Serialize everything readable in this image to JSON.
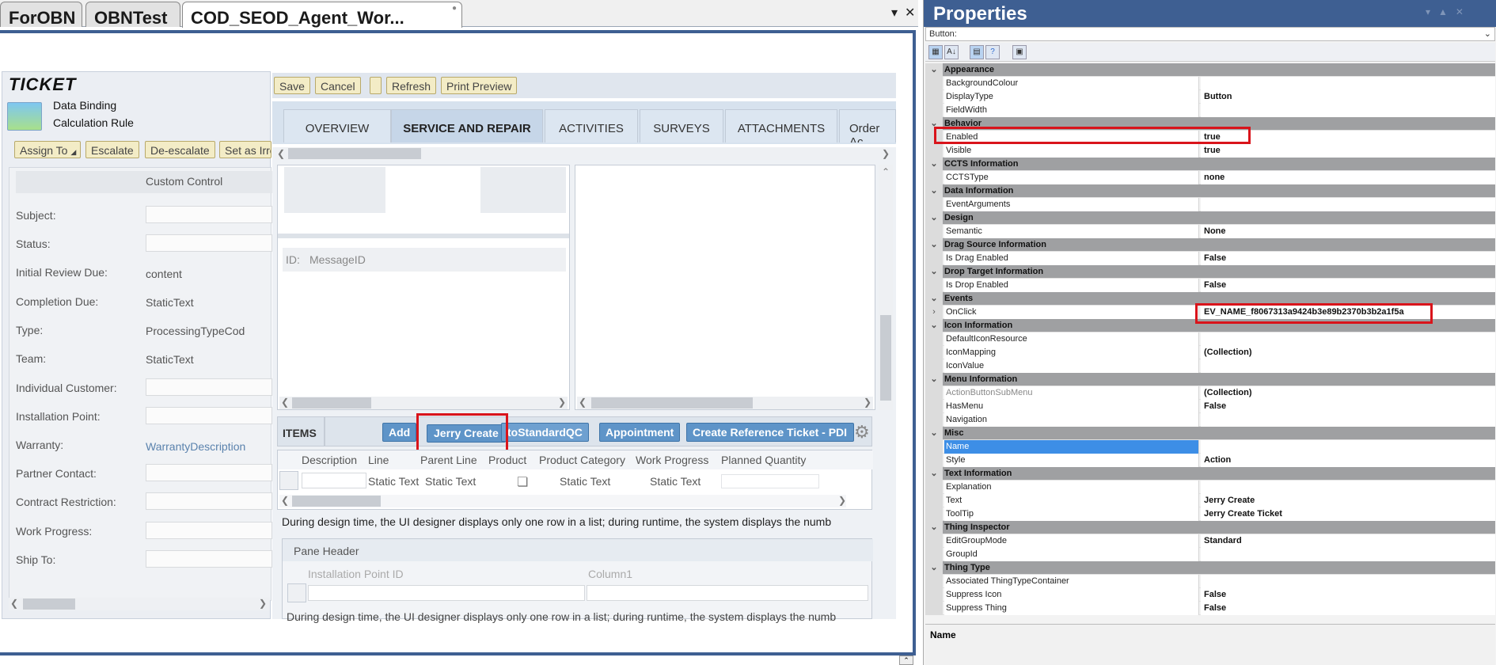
{
  "doc_tabs": [
    "ForOBN",
    "OBNTest",
    "COD_SEOD_Agent_Wor..."
  ],
  "ticket": {
    "title": "TICKET",
    "data_binding": "Data Binding",
    "calc_rule": "Calculation Rule",
    "actions": [
      "Assign To",
      "Escalate",
      "De-escalate",
      "Set as Irre"
    ],
    "custom_control": "Custom Control",
    "fields": [
      {
        "label": "Subject:",
        "value": ""
      },
      {
        "label": "Status:",
        "value": ""
      },
      {
        "label": "Initial Review Due:",
        "value": "content"
      },
      {
        "label": "Completion Due:",
        "value": "StaticText"
      },
      {
        "label": "Type:",
        "value": "ProcessingTypeCode"
      },
      {
        "label": "Team:",
        "value": "StaticText"
      },
      {
        "label": "Individual Customer:",
        "value": ""
      },
      {
        "label": "Installation Point:",
        "value": ""
      },
      {
        "label": "Warranty:",
        "value": "WarrantyDescription"
      },
      {
        "label": "Partner Contact:",
        "value": ""
      },
      {
        "label": "Contract Restriction:",
        "value": ""
      },
      {
        "label": "Work Progress:",
        "value": ""
      },
      {
        "label": "Ship To:",
        "value": ""
      }
    ]
  },
  "toolbar": {
    "save": "Save",
    "cancel": "Cancel",
    "refresh": "Refresh",
    "print_preview": "Print Preview"
  },
  "center_tabs": [
    "OVERVIEW",
    "SERVICE AND REPAIR",
    "ACTIVITIES",
    "SURVEYS",
    "ATTACHMENTS",
    "Order Ac"
  ],
  "message": {
    "id_label": "ID:",
    "id_value": "MessageID"
  },
  "items": {
    "title": "ITEMS",
    "buttons": [
      "Add",
      "Jerry Create",
      "toStandardQC",
      "Appointment",
      "Create Reference Ticket - PDI"
    ],
    "columns": [
      "Description",
      "Line",
      "Parent Line",
      "Product",
      "Product Category",
      "Work Progress",
      "Planned Quantity"
    ],
    "row": [
      "",
      "Static Text",
      "Static Text",
      "",
      "Static Text",
      "Static Text",
      ""
    ],
    "note": "During design time, the UI designer displays only one row in a list; during runtime, the system displays the numb"
  },
  "pane": {
    "header": "Pane Header",
    "columns": [
      "Installation Point ID",
      "Column1"
    ],
    "note": "During design time, the UI designer displays only one row in a list; during runtime, the system displays the numb"
  },
  "properties": {
    "title": "Properties",
    "selector": "Button:",
    "rows": [
      {
        "t": "cat",
        "label": "Appearance"
      },
      {
        "t": "prop",
        "label": "BackgroundColour",
        "value": ""
      },
      {
        "t": "prop",
        "label": "DisplayType",
        "value": "Button"
      },
      {
        "t": "prop",
        "label": "FieldWidth",
        "value": ""
      },
      {
        "t": "cat",
        "label": "Behavior"
      },
      {
        "t": "prop",
        "label": "Enabled",
        "value": "true"
      },
      {
        "t": "prop",
        "label": "Visible",
        "value": "true"
      },
      {
        "t": "cat",
        "label": "CCTS Information"
      },
      {
        "t": "prop",
        "label": "CCTSType",
        "value": "none"
      },
      {
        "t": "cat",
        "label": "Data Information"
      },
      {
        "t": "prop",
        "label": "EventArguments",
        "value": ""
      },
      {
        "t": "cat",
        "label": "Design"
      },
      {
        "t": "prop",
        "label": "Semantic",
        "value": "None"
      },
      {
        "t": "cat",
        "label": "Drag Source Information"
      },
      {
        "t": "prop",
        "label": "Is Drag Enabled",
        "value": "False"
      },
      {
        "t": "cat",
        "label": "Drop Target Information"
      },
      {
        "t": "prop",
        "label": "Is Drop Enabled",
        "value": "False"
      },
      {
        "t": "cat",
        "label": "Events"
      },
      {
        "t": "prop",
        "label": "OnClick",
        "value": "EV_NAME_f8067313a9424b3e89b2370b3b2a1f5a"
      },
      {
        "t": "cat",
        "label": "Icon Information"
      },
      {
        "t": "prop",
        "label": "DefaultIconResource",
        "value": ""
      },
      {
        "t": "prop",
        "label": "IconMapping",
        "value": "(Collection)"
      },
      {
        "t": "prop",
        "label": "IconValue",
        "value": ""
      },
      {
        "t": "cat",
        "label": "Menu Information"
      },
      {
        "t": "prop",
        "label": "ActionButtonSubMenu",
        "value": "(Collection)"
      },
      {
        "t": "prop",
        "label": "HasMenu",
        "value": "False"
      },
      {
        "t": "prop",
        "label": "Navigation",
        "value": ""
      },
      {
        "t": "cat",
        "label": "Misc"
      },
      {
        "t": "prop",
        "label": "Name",
        "value": ""
      },
      {
        "t": "prop",
        "label": "Style",
        "value": "Action"
      },
      {
        "t": "cat",
        "label": "Text Information"
      },
      {
        "t": "prop",
        "label": "Explanation",
        "value": ""
      },
      {
        "t": "prop",
        "label": "Text",
        "value": "Jerry Create"
      },
      {
        "t": "prop",
        "label": "ToolTip",
        "value": "Jerry Create Ticket"
      },
      {
        "t": "cat",
        "label": "Thing Inspector"
      },
      {
        "t": "prop",
        "label": "EditGroupMode",
        "value": "Standard"
      },
      {
        "t": "prop",
        "label": "GroupId",
        "value": ""
      },
      {
        "t": "cat",
        "label": "Thing Type"
      },
      {
        "t": "prop",
        "label": "Associated ThingTypeContainer",
        "value": ""
      },
      {
        "t": "prop",
        "label": "Suppress Icon",
        "value": "False"
      },
      {
        "t": "prop",
        "label": "Suppress Thing",
        "value": "False"
      }
    ],
    "description": "Name"
  }
}
